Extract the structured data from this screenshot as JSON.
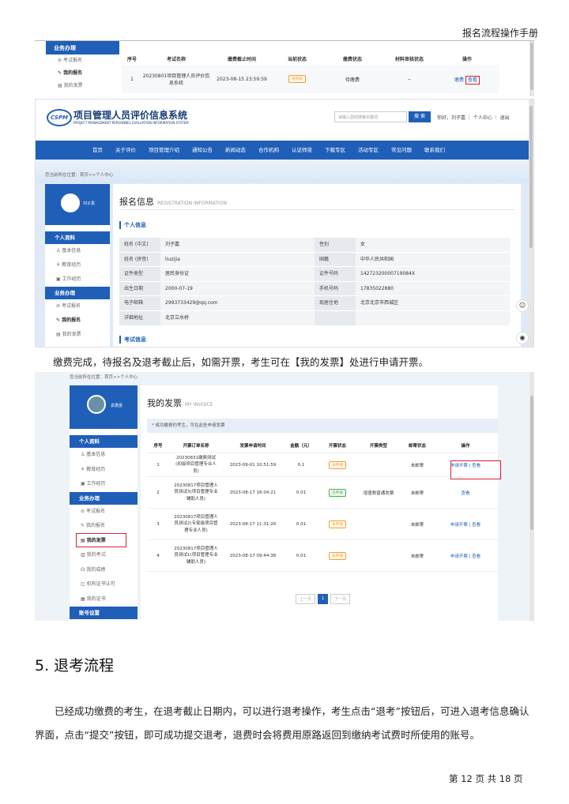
{
  "header": {
    "manual_title": "报名流程操作手册"
  },
  "shot1": {
    "side": {
      "group": "业务办理",
      "items": [
        "考试报名",
        "我的报名",
        "我的发票"
      ]
    },
    "table": {
      "headers": [
        "序号",
        "考试名称",
        "缴费截止时间",
        "当前状态",
        "缴费状态",
        "材料审核状态",
        "操作"
      ],
      "row": {
        "no": "1",
        "name": "20230801项目管理人员评价信息系统",
        "deadline": "2023-08-15 23:59:59",
        "status": "待审核",
        "pay": "待缴费",
        "review": "--",
        "op1": "缴费",
        "op2": "查看"
      }
    }
  },
  "shot2": {
    "site_title": "项目管理人员评价信息系统",
    "site_sub": "PROJECT MANAGEMENT PERSONNEL EVALUATION INFORMATION SYSTEM",
    "logo": "CSPM",
    "search_placeholder": "请输入您的搜索关键词",
    "search_btn": "搜 索",
    "top_links": "你好，刘子嘉 ｜ 个人中心 ｜ 退出",
    "nav": [
      "首页",
      "关于评价",
      "项目管理介绍",
      "通知公告",
      "新闻动态",
      "合作机构",
      "认证师资",
      "下载专区",
      "活动专区",
      "常见问题",
      "联系我们"
    ],
    "crumb": "您当前所在位置：首页>>个人中心",
    "user": "刘子嘉",
    "side": [
      {
        "type": "head",
        "label": "个人资料"
      },
      {
        "type": "item",
        "label": "基本信息"
      },
      {
        "type": "item",
        "label": "教育经历"
      },
      {
        "type": "item",
        "label": "工作经历"
      },
      {
        "type": "head",
        "label": "业务办理"
      },
      {
        "type": "item",
        "label": "考试报名"
      },
      {
        "type": "bold",
        "label": "我的报名"
      },
      {
        "type": "item",
        "label": "我的发票"
      }
    ],
    "title": "报名信息",
    "title_en": "REGISTRATION INFORMATION",
    "sec1": "个人信息",
    "sec2": "考试信息",
    "info": [
      [
        "姓名 (中文)",
        "刘子嘉",
        "性别",
        "女"
      ],
      [
        "姓名 (拼音)",
        "liuzijia",
        "国籍",
        "中华人民共和国"
      ],
      [
        "证件类型",
        "居民身份证",
        "证件号码",
        "14272320000719084X"
      ],
      [
        "出生日期",
        "2000-07-19",
        "手机号码",
        "17835022880"
      ],
      [
        "电子邮箱",
        "2993733429@qq.com",
        "现居住地",
        "北京北京市西城区"
      ],
      [
        "详细地址",
        "北京立水桥",
        "",
        ""
      ]
    ]
  },
  "para1": "缴费完成，待报名及退考截止后，如需开票，考生可在【我的发票】处进行申请开票。",
  "shot3": {
    "crumb": "您当前所在位置：首页>>个人中心",
    "user": "袁惠雯",
    "side": [
      {
        "type": "head",
        "label": "个人资料"
      },
      {
        "type": "item",
        "label": "基本信息"
      },
      {
        "type": "item",
        "label": "教育经历"
      },
      {
        "type": "item",
        "label": "工作经历"
      },
      {
        "type": "head",
        "label": "业务办理"
      },
      {
        "type": "item",
        "label": "考试报名"
      },
      {
        "type": "item",
        "label": "我的报名"
      },
      {
        "type": "bold",
        "label": "我的发票"
      },
      {
        "type": "item",
        "label": "我的考试"
      },
      {
        "type": "item",
        "label": "我的成绩"
      },
      {
        "type": "item",
        "label": "机构证书认可"
      },
      {
        "type": "item",
        "label": "我的证书"
      },
      {
        "type": "head",
        "label": "账号设置"
      }
    ],
    "title": "我的发票",
    "title_en": "MY INVOICE",
    "notice": "* 成功缴费的考生，可在此处申请发票",
    "headers": [
      "序号",
      "开票订单名称",
      "发票申请时间",
      "金额（元）",
      "开票状态",
      "开票类型",
      "邮寄状态",
      "操作"
    ],
    "rows": [
      {
        "no": "1",
        "name": "20230831缴费测试(初级项目管理专业人员)",
        "time": "2023-09-01 10:51:59",
        "amt": "0.1",
        "state": "未申请",
        "kind": "",
        "mail": "未邮寄",
        "op": "申请开票 | 查看"
      },
      {
        "no": "2",
        "name": "20230817项目管理人员测试3(项目管理专业辅助人员)",
        "time": "2023-08-17 16:04:21",
        "amt": "0.01",
        "state": "已申请",
        "kind": "增值税普通发票",
        "mail": "未邮寄",
        "op": "查看"
      },
      {
        "no": "3",
        "name": "20230817项目管理人员测试2(专家级项目管理专业人员)",
        "time": "2023-08-17 11:31:26",
        "amt": "0.01",
        "state": "未申请",
        "kind": "",
        "mail": "未邮寄",
        "op": "申请开票 | 查看"
      },
      {
        "no": "4",
        "name": "20230817项目管理人员测试1(项目管理专业辅助人员)",
        "time": "2023-08-17 09:44:38",
        "amt": "0.01",
        "state": "未申请",
        "kind": "",
        "mail": "未邮寄",
        "op": "申请开票 | 查看"
      }
    ],
    "pager": {
      "prev": "上一页",
      "cur": "1",
      "next": "下一页"
    }
  },
  "section": {
    "heading": "5. 退考流程",
    "body": "已经成功缴费的考生，在退考截止日期内，可以进行退考操作，考生点击“退考”按钮后，可进入退考信息确认界面，点击“提交”按钮，即可成功提交退考，退费时会将费用原路返回到缴纳考试费时所使用的账号。"
  },
  "footer": {
    "page": "第 12 页 共 18 页"
  }
}
